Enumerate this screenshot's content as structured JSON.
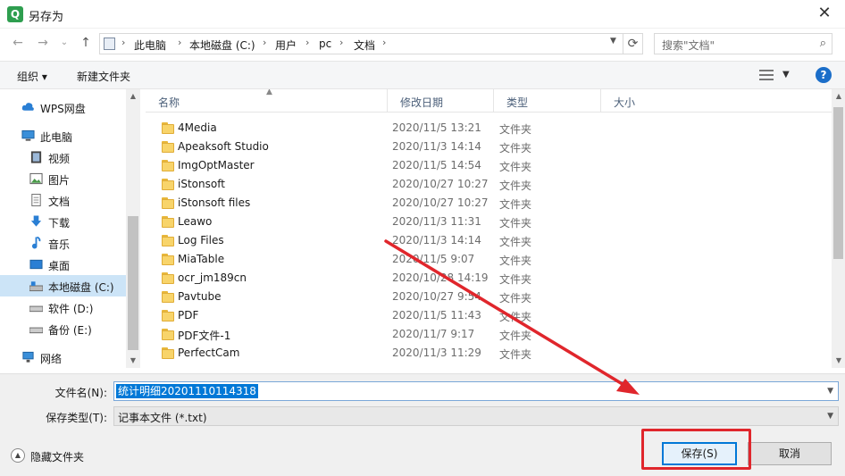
{
  "window": {
    "title": "另存为",
    "app_icon_letter": "Q",
    "close_glyph": "✕"
  },
  "nav": {
    "back": "←",
    "forward": "→",
    "dropdown": "⌄",
    "up": "↑"
  },
  "breadcrumb": {
    "separator": "›",
    "items": [
      "此电脑",
      "本地磁盘 (C:)",
      "用户",
      "pc",
      "文档"
    ]
  },
  "search": {
    "placeholder": "搜索\"文档\""
  },
  "toolbar": {
    "organize": "组织 ▾",
    "new_folder": "新建文件夹",
    "help": "?"
  },
  "sidebar": {
    "items": [
      {
        "label": "WPS网盘",
        "icon": "cloud-icon"
      },
      {
        "label": "此电脑",
        "icon": "computer-icon"
      },
      {
        "label": "视频",
        "icon": "video-icon"
      },
      {
        "label": "图片",
        "icon": "picture-icon"
      },
      {
        "label": "文档",
        "icon": "document-icon"
      },
      {
        "label": "下载",
        "icon": "download-icon"
      },
      {
        "label": "音乐",
        "icon": "music-icon"
      },
      {
        "label": "桌面",
        "icon": "desktop-icon"
      },
      {
        "label": "本地磁盘 (C:)",
        "icon": "drive-icon"
      },
      {
        "label": "软件 (D:)",
        "icon": "drive-icon"
      },
      {
        "label": "备份 (E:)",
        "icon": "drive-icon"
      },
      {
        "label": "网络",
        "icon": "network-icon"
      }
    ]
  },
  "columns": {
    "name": "名称",
    "date": "修改日期",
    "type": "类型",
    "size": "大小"
  },
  "files": [
    {
      "name": "4Media",
      "date": "2020/11/5 13:21",
      "type": "文件夹"
    },
    {
      "name": "Apeaksoft Studio",
      "date": "2020/11/3 14:14",
      "type": "文件夹"
    },
    {
      "name": "ImgOptMaster",
      "date": "2020/11/5 14:54",
      "type": "文件夹"
    },
    {
      "name": "iStonsoft",
      "date": "2020/10/27 10:27",
      "type": "文件夹"
    },
    {
      "name": "iStonsoft files",
      "date": "2020/10/27 10:27",
      "type": "文件夹"
    },
    {
      "name": "Leawo",
      "date": "2020/11/3 11:31",
      "type": "文件夹"
    },
    {
      "name": "Log Files",
      "date": "2020/11/3 14:14",
      "type": "文件夹"
    },
    {
      "name": "MiaTable",
      "date": "2020/11/5 9:07",
      "type": "文件夹"
    },
    {
      "name": "ocr_jm189cn",
      "date": "2020/10/28 14:19",
      "type": "文件夹"
    },
    {
      "name": "Pavtube",
      "date": "2020/10/27 9:54",
      "type": "文件夹"
    },
    {
      "name": "PDF",
      "date": "2020/11/5 11:43",
      "type": "文件夹"
    },
    {
      "name": "PDF文件-1",
      "date": "2020/11/7 9:17",
      "type": "文件夹"
    },
    {
      "name": "PerfectCam",
      "date": "2020/11/3 11:29",
      "type": "文件夹"
    }
  ],
  "form": {
    "filename_label": "文件名(N):",
    "filename_value": "统计明细20201110114318",
    "filetype_label": "保存类型(T):",
    "filetype_value": "记事本文件 (*.txt)"
  },
  "footer": {
    "hide_folders": "隐藏文件夹",
    "save": "保存(S)",
    "cancel": "取消"
  },
  "colors": {
    "annotation": "#e0262c",
    "accent": "#0078d7"
  }
}
